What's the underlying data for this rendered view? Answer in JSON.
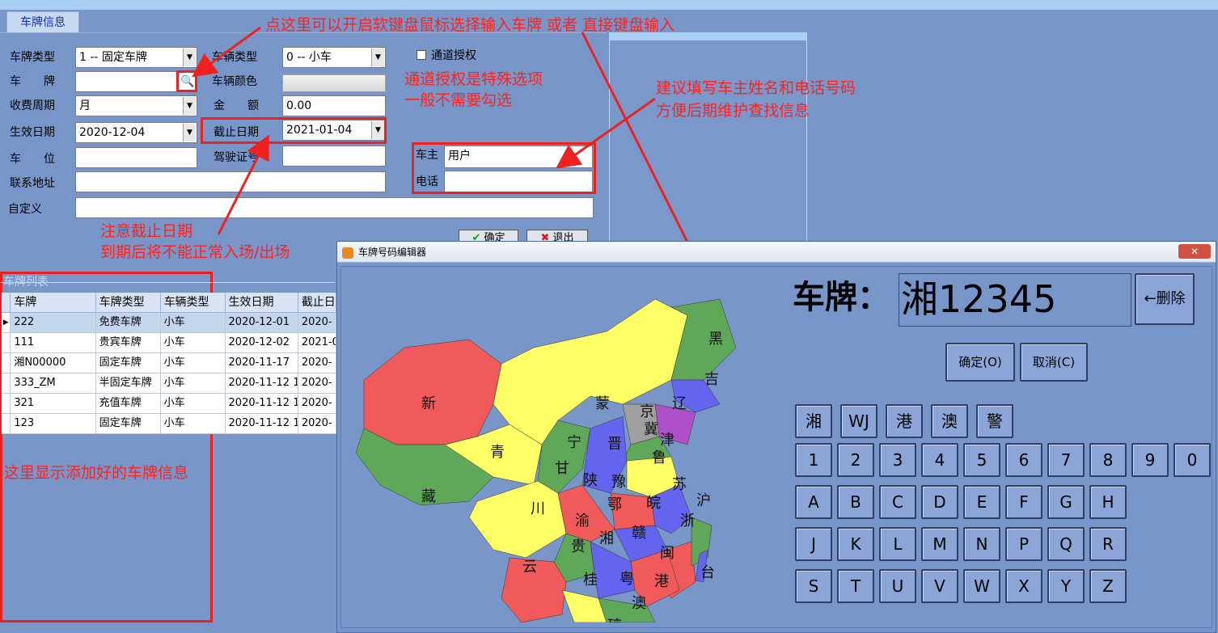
{
  "tab": {
    "label": "车牌信息"
  },
  "form": {
    "plate_type": {
      "label": "车牌类型",
      "value": "1 -- 固定车牌"
    },
    "vehicle_type": {
      "label": "车辆类型",
      "value": "0 -- 小车"
    },
    "channel_auth": {
      "label": "通道授权"
    },
    "plate": {
      "label": "车　　牌",
      "value": ""
    },
    "vehicle_color": {
      "label": "车辆颜色"
    },
    "billing_cycle": {
      "label": "收费周期",
      "value": "月"
    },
    "amount": {
      "label": "金　　额",
      "value": "0.00"
    },
    "effective_date": {
      "label": "生效日期",
      "value": "2020-12-04"
    },
    "expiry_date": {
      "label": "截止日期",
      "value": "2021-01-04"
    },
    "parking_space": {
      "label": "车　　位",
      "value": ""
    },
    "license_no": {
      "label": "驾驶证号",
      "value": ""
    },
    "owner": {
      "label": "车主",
      "value": "用户"
    },
    "phone": {
      "label": "电话",
      "value": ""
    },
    "address": {
      "label": "联系地址",
      "value": ""
    },
    "custom": {
      "label": "自定义",
      "value": ""
    },
    "ok_label": "确定",
    "exit_label": "退出"
  },
  "annotations": {
    "keyboard_hint": "点这里可以开启软键盘鼠标选择输入车牌 或者 直接键盘输入",
    "auth_hint_1": "通道授权是特殊选项",
    "auth_hint_2": "一般不需要勾选",
    "owner_hint_1": "建议填写车主姓名和电话号码",
    "owner_hint_2": "方便后期维护查找信息",
    "expiry_hint_1": "注意截止日期",
    "expiry_hint_2": "到期后将不能正常入场/出场",
    "list_hint": "这里显示添加好的车牌信息"
  },
  "plate_list": {
    "title": "车牌列表",
    "columns": [
      "车牌",
      "车牌类型",
      "车辆类型",
      "生效日期",
      "截止日"
    ],
    "rows": [
      [
        "222",
        "免费车牌",
        "小车",
        "2020-12-01",
        "2020-"
      ],
      [
        "111",
        "贵宾车牌",
        "小车",
        "2020-12-02",
        "2021-0"
      ],
      [
        "湘N00000",
        "固定车牌",
        "小车",
        "2020-11-17",
        "2020-"
      ],
      [
        "333_ZM",
        "半固定车牌",
        "小车",
        "2020-11-12 1",
        "2020-"
      ],
      [
        "321",
        "充值车牌",
        "小车",
        "2020-11-12 1",
        "2020-"
      ],
      [
        "123",
        "固定车牌",
        "小车",
        "2020-11-12 1",
        "2020-"
      ]
    ]
  },
  "editor": {
    "title": "车牌号码编辑器",
    "plate_label": "车牌：",
    "plate_value": "湘12345",
    "delete_label": "←删除",
    "confirm_label": "确定(O)",
    "cancel_label": "取消(C)",
    "special_keys": [
      "湘",
      "WJ",
      "港",
      "澳",
      "警"
    ],
    "digit_keys": [
      "1",
      "2",
      "3",
      "4",
      "5",
      "6",
      "7",
      "8",
      "9",
      "0"
    ],
    "letter_rows": [
      [
        "A",
        "B",
        "C",
        "D",
        "E",
        "F",
        "G",
        "H"
      ],
      [
        "J",
        "K",
        "L",
        "M",
        "N",
        "P",
        "Q",
        "R"
      ],
      [
        "S",
        "T",
        "U",
        "V",
        "W",
        "X",
        "Y",
        "Z"
      ]
    ],
    "provinces": [
      "黑",
      "吉",
      "辽",
      "新",
      "蒙",
      "京",
      "冀",
      "津",
      "宁",
      "晋",
      "鲁",
      "青",
      "甘",
      "陕",
      "豫",
      "苏",
      "藏",
      "鄂",
      "皖",
      "沪",
      "川",
      "渝",
      "浙",
      "贵",
      "湘",
      "赣",
      "闽",
      "云",
      "桂",
      "粤",
      "台",
      "港",
      "澳",
      "琼"
    ]
  },
  "colors": {
    "background": "#7896c8",
    "annotation_red": "#ee2020",
    "map_red": "#f05a5a",
    "map_yellow": "#ffff66",
    "map_green": "#5fa85a",
    "map_blue": "#6464ee"
  }
}
